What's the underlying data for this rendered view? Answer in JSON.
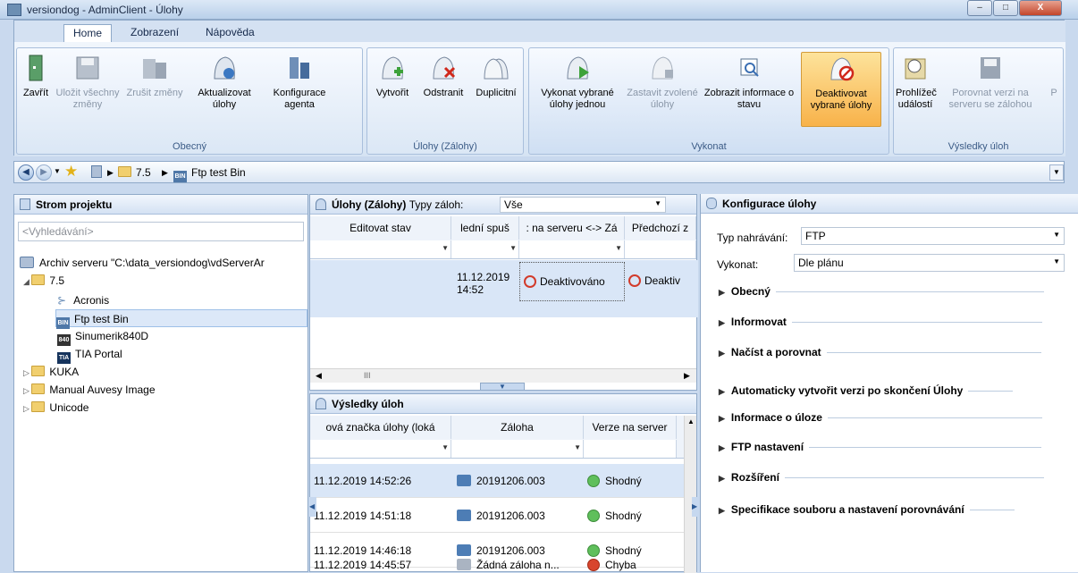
{
  "window": {
    "title": "versiondog - AdminClient - Úlohy",
    "min": "–",
    "max": "□",
    "close": "X"
  },
  "ribbon_tabs": [
    "Home",
    "Zobrazení",
    "Nápověda"
  ],
  "groups": {
    "obecny": {
      "label": "Obecný",
      "buttons": [
        "Zavřít",
        "Uložit všechny změny",
        "Zrušit změny",
        "Aktualizovat úlohy",
        "Konfigurace agenta"
      ]
    },
    "ulohy": {
      "label": "Úlohy (Zálohy)",
      "buttons": [
        "Vytvořit",
        "Odstranit",
        "Duplicitní"
      ]
    },
    "vykonat": {
      "label": "Vykonat",
      "buttons": [
        "Vykonat vybrané úlohy jednou",
        "Zastavit zvolené úlohy",
        "Zobrazit informace o stavu",
        "Deaktivovat vybrané úlohy"
      ]
    },
    "vysledky": {
      "label": "Výsledky úloh",
      "buttons": [
        "Prohlížeč událostí",
        "Porovnat verzi na serveru se zálohou",
        "P"
      ]
    }
  },
  "address": {
    "crumbs": [
      "7.5",
      "Ftp test Bin"
    ]
  },
  "left": {
    "title": "Strom projektu",
    "search_placeholder": "<Vyhledávání>",
    "root": "Archiv serveru \"C:\\data_versiondog\\vdServerAr",
    "folder75": "7.5",
    "children": [
      "Acronis",
      "Ftp test Bin",
      "Sinumerik840D",
      "TIA Portal"
    ],
    "folders": [
      "KUKA",
      "Manual Auvesy Image",
      "Unicode"
    ]
  },
  "tasks": {
    "title": "Úlohy (Zálohy)",
    "type_label": "Typy záloh:",
    "type_value": "Vše",
    "columns": [
      "Editovat stav",
      "lední spuš",
      ": na serveru <-> Zá",
      "Předchozí z"
    ],
    "row": {
      "date": "11.12.2019",
      "time": "14:52",
      "status1": "Deaktivováno",
      "status2": "Deaktiv"
    },
    "scroll_text": "III"
  },
  "results": {
    "title": "Výsledky úloh",
    "columns": [
      "ová značka úlohy (loká",
      "Záloha",
      "Verze na server"
    ],
    "rows": [
      {
        "ts": "11.12.2019 14:52:26",
        "backup": "20191206.003",
        "status": "Shodný"
      },
      {
        "ts": "11.12.2019 14:51:18",
        "backup": "20191206.003",
        "status": "Shodný"
      },
      {
        "ts": "11.12.2019 14:46:18",
        "backup": "20191206.003",
        "status": "Shodný"
      },
      {
        "ts": "11.12.2019 14:45:57",
        "backup": "Žádná záloha n...",
        "status": "Chyba"
      }
    ]
  },
  "config": {
    "title": "Konfigurace úlohy",
    "upload_label": "Typ nahrávání:",
    "upload_value": "FTP",
    "run_label": "Vykonat:",
    "run_value": "Dle plánu",
    "sections": [
      "Obecný",
      "Informovat",
      "Načíst a porovnat",
      "Automaticky vytvořit verzi po skončení Úlohy",
      "Informace o úloze",
      "FTP nastavení",
      "Rozšíření",
      "Specifikace souboru a nastavení porovnávání"
    ]
  }
}
